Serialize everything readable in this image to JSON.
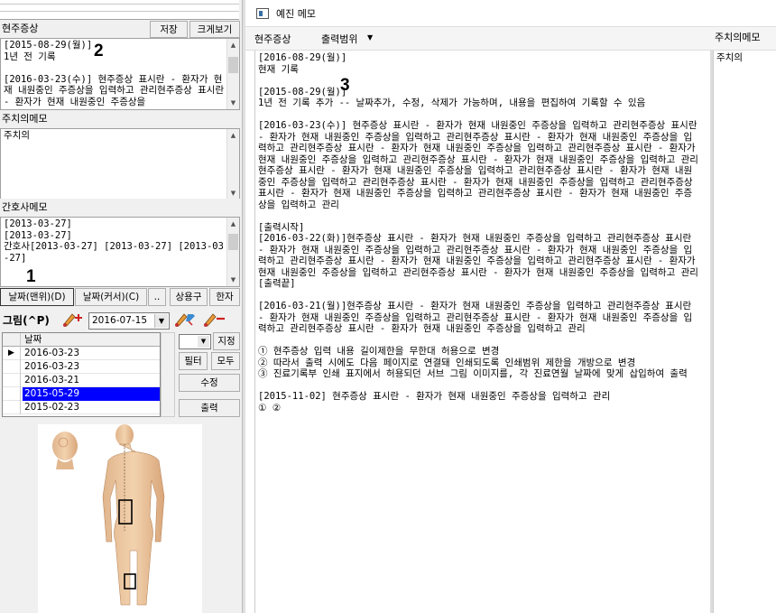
{
  "left": {
    "current_symptom": {
      "title": "현주증상",
      "save_label": "저장",
      "enlarge_label": "크게보기",
      "content": "[2015-08-29(월)]\n1년 전 기록\n\n[2016-03-23(수)] 현주증상 표시란 - 환자가 현재 내원중인 주증상을 입력하고 관리현주증상 표시란 - 환자가 현재 내원중인 주증상을"
    },
    "doctor_memo": {
      "title": "주치의메모",
      "content": "주치의"
    },
    "nurse_memo": {
      "title": "간호사메모",
      "content": "[2013-03-27]\n[2013-03-27]\n간호사[2013-03-27] [2013-03-27] [2013-03-27]"
    },
    "tabs": {
      "date_top": "날짜(맨위)(D)",
      "date_cursor": "날짜(커서)(C)",
      "dots": "..",
      "common_phrase": "상용구",
      "hanja": "한자"
    },
    "drawing": {
      "label": "그림(^P)",
      "date": "2016-07-15"
    },
    "grid": {
      "header": "날짜",
      "rows": [
        "2016-03-23",
        "2016-03-23",
        "2016-03-21",
        "2015-05-29",
        "2015-02-23"
      ],
      "selected_index": 3,
      "assign_label": "지정",
      "filter_label": "필터",
      "all_label": "모두",
      "edit_label": "수정",
      "print_label": "출력"
    }
  },
  "annotations": {
    "one": "1",
    "two": "2",
    "three": "3"
  },
  "preview": {
    "title": "예진 메모",
    "toolbar": {
      "current_symptom": "현주증상",
      "print_range": "출력범위"
    },
    "doctor_memo_header": "주치의메모",
    "doctor_memo_content": "주치의",
    "body": "[2016-08-29(월)]\n현재 기록\n\n[2015-08-29(월)]\n1년 전 기록 추가 -- 날짜추가, 수정, 삭제가 가능하며, 내용을 편집하여 기록할 수 있음\n\n[2016-03-23(수)] 현주증상 표시란 - 환자가 현재 내원중인 주증상을 입력하고 관리현주증상 표시란 - 환자가 현재 내원중인 주증상을 입력하고 관리현주증상 표시란 - 환자가 현재 내원중인 주증상을 입력하고 관리현주증상 표시란 - 환자가 현재 내원중인 주증상을 입력하고 관리현주증상 표시란 - 환자가 현재 내원중인 주증상을 입력하고 관리현주증상 표시란 - 환자가 현재 내원중인 주증상을 입력하고 관리현주증상 표시란 - 환자가 현재 내원중인 주증상을 입력하고 관리현주증상 표시란 - 환자가 현재 내원중인 주증상을 입력하고 관리현주증상 표시란 - 환자가 현재 내원중인 주증상을 입력하고 관리현주증상 표시란 - 환자가 현재 내원중인 주증상을 입력하고 관리현주증상 표시란 - 환자가 현재 내원중인 주증상을 입력하고 관리\n\n[출력시작]\n[2016-03-22(화)]현주증상 표시란 - 환자가 현재 내원중인 주증상을 입력하고 관리현주증상 표시란 - 환자가 현재 내원중인 주증상을 입력하고 관리현주증상 표시란 - 환자가 현재 내원중인 주증상을 입력하고 관리현주증상 표시란 - 환자가 현재 내원중인 주증상을 입력하고 관리현주증상 표시란 - 환자가 현재 내원중인 주증상을 입력하고 관리현주증상 표시란 - 환자가 현재 내원중인 주증상을 입력하고 관리\n[출력끝]\n\n[2016-03-21(월)]현주증상 표시란 - 환자가 현재 내원중인 주증상을 입력하고 관리현주증상 표시란 - 환자가 현재 내원중인 주증상을 입력하고 관리현주증상 표시란 - 환자가 현재 내원중인 주증상을 입력하고 관리현주증상 표시란 - 환자가 현재 내원중인 주증상을 입력하고 관리\n\n① 현주증상 입력 내용 길이제한을 무한대 허용으로 변경\n② 따라서 출력 시에도 다음 페이지로 연결돼 인쇄되도록 인쇄범위 제한을 개방으로 변경\n③ 진료기록부 인쇄 표지에서 허용되던 서브 그림 이미지를, 각 진료연월 날짜에 맞게 삽입하여 출력\n\n[2015-11-02] 현주증상 표시란 - 환자가 현재 내원중인 주증상을 입력하고 관리\n① ②"
  }
}
